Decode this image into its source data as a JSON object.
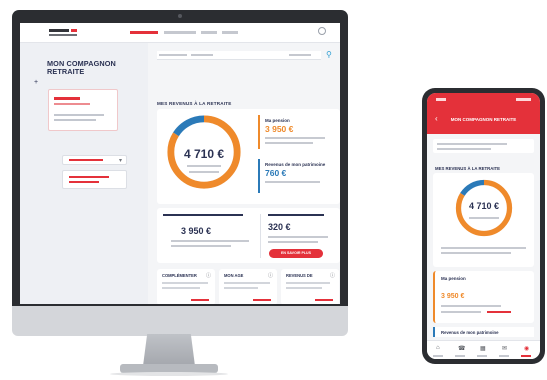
{
  "desktop": {
    "sidebar": {
      "title": "MON COMPAGNON\nRETRAITE",
      "add_icon": "+",
      "select_chevron": "▾"
    },
    "main": {
      "section_title": "MES REVENUS À LA RETRAITE",
      "total_amount": "4 710 €",
      "stats": [
        {
          "title": "Ma pension",
          "amount": "3 950 €",
          "accent": "#ef8a2b"
        },
        {
          "title": "Revenus de mon patrimoine",
          "amount": "760 €",
          "accent": "#2b7ab8"
        }
      ],
      "lower_left_amount": "3 950 €",
      "lower_right_amount": "320 €",
      "lower_button": "EN SAVOIR PLUS",
      "mini_cards": [
        "COMPLÉMENTER",
        "MON AGE",
        "REVENUS DE"
      ]
    }
  },
  "phone": {
    "header_title": "MON COMPAGNON RETRAITE",
    "back_icon": "‹",
    "section_title": "MES REVENUS À LA RETRAITE",
    "total_amount": "4 710 €",
    "pension_title": "Ma pension",
    "pension_amount": "3 950 €",
    "patrimoine_title": "Revenus de mon patrimoine",
    "tabbar_icons": [
      "⌂",
      "☎",
      "▦",
      "✉",
      "◉"
    ]
  },
  "colors": {
    "brand_red": "#e4313a",
    "orange": "#ef8a2b",
    "blue": "#2b7ab8",
    "navy": "#2b3253"
  },
  "chart_data": {
    "type": "pie",
    "categories": [
      "Ma pension",
      "Revenus de mon patrimoine"
    ],
    "values": [
      3950,
      760
    ],
    "total": "4 710 €"
  }
}
